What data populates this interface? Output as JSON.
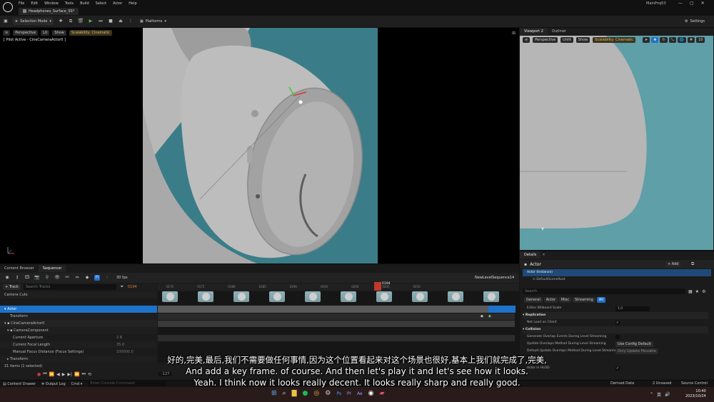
{
  "menu": {
    "items": [
      "File",
      "Edit",
      "Window",
      "Tools",
      "Build",
      "Select",
      "Actor",
      "Help"
    ],
    "project": "MainProj03",
    "level_tab": "Headphones_Surface_SS*"
  },
  "toolbar": {
    "selection_mode": "Selection Mode",
    "platforms": "Platforms",
    "settings": "Settings"
  },
  "viewport": {
    "perspective": "Perspective",
    "lit": "Lit",
    "show": "Show",
    "scalability": "Scalability: Cinematic",
    "pilot": "[ Pilot Active - CineCameraActor0 ]"
  },
  "viewport2": {
    "tab": "Viewport 2",
    "outliner_tab": "Outliner",
    "perspective": "Perspective",
    "unlit": "Unlit",
    "show": "Show",
    "scalability": "Scalability: Cinematic",
    "grid_value": "10"
  },
  "sequencer": {
    "tab_content_browser": "Content Browser",
    "tab_sequencer": "Sequencer",
    "fps": "30 fps",
    "sequence_name": "NewLevelSequence14",
    "track_button": "+ Track",
    "search_placeholder": "Search Tracks",
    "current_frame": "0194",
    "playhead_frame": "0194",
    "ruler_ticks": [
      "0170",
      "0175",
      "0180",
      "0185",
      "0190",
      "0195",
      "0200",
      "0205",
      "0210"
    ],
    "tracks": [
      {
        "label": "Camera Cuts",
        "indent": 0
      },
      {
        "label": "Actor",
        "indent": 0,
        "selected": true
      },
      {
        "label": "Transform",
        "indent": 1
      },
      {
        "label": "CineCameraActor0",
        "indent": 0
      },
      {
        "label": "CameraComponent",
        "indent": 1
      },
      {
        "label": "Current Aperture",
        "indent": 2,
        "value": "2.8"
      },
      {
        "label": "Current Focal Length",
        "indent": 2,
        "value": "35.0"
      },
      {
        "label": "Manual Focus Distance (Focus Settings)",
        "indent": 2,
        "value": "100000.0"
      },
      {
        "label": "Transform",
        "indent": 1
      }
    ],
    "items_count": "21 items (1 selected)",
    "end_frame": "-127"
  },
  "details": {
    "tab": "Details",
    "actor_title": "Actor",
    "add_button": "+ Add",
    "instance": "Actor (Instance)",
    "scene_root": "DefaultSceneRoot",
    "search_placeholder": "Search",
    "filters": [
      "General",
      "Actor",
      "Misc",
      "Streaming",
      "All"
    ],
    "editor_billboard_scale_label": "Editor Billboard Scale",
    "editor_billboard_scale_value": "1.0",
    "replication_header": "Replication",
    "net_load_label": "Net Load on Client",
    "collision_header": "Collision",
    "overlap_label": "Generate Overlap Events During Level Streaming",
    "update_overlap_label": "Update Overlaps Method During Level Streaming",
    "update_overlap_value": "Use Config Default",
    "default_update_label": "Default Update Overlaps Method During Level Streaming",
    "default_update_value": "Only Update Movable",
    "hud_label": "Actor in HLOD"
  },
  "statusbar": {
    "content_drawer": "Content Drawer",
    "output_log": "Output Log",
    "cmd": "Cmd",
    "console_placeholder": "Enter Console Command",
    "derived_data": "Derived Data",
    "unsaved": "2 Unsaved",
    "source_control": "Source Control"
  },
  "taskbar": {
    "time": "10:40",
    "date": "2023/10/24",
    "lang": "英"
  },
  "subtitles": {
    "line_cn": "好的,完美,最后,我们不需要做任何事情,因为这个位置看起来对这个场景也很好,基本上我们就完成了,完美,",
    "line1": "And add a key frame. of course. And then let's play it and let's see how it looks.",
    "line2": "Yeah. I think now it looks really decent. It looks really sharp and really good."
  },
  "colors": {
    "viewport_bg": "#2f6b78",
    "selection_blue": "#1f72c9",
    "scalability_yellow": "#e0c060",
    "playhead_red": "#c0392b"
  }
}
